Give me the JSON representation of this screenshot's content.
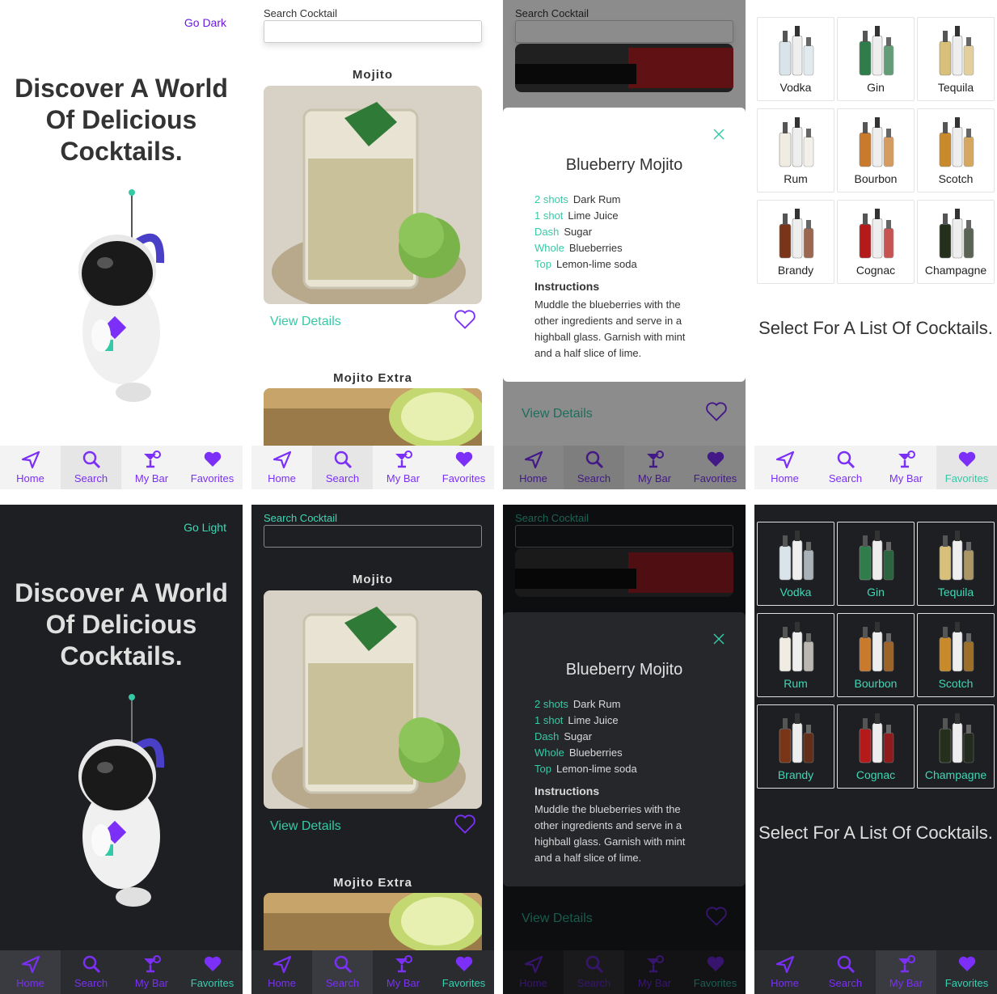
{
  "nav": {
    "home": "Home",
    "search": "Search",
    "mybar": "My Bar",
    "favorites": "Favorites"
  },
  "home": {
    "toggle_light": "Go Dark",
    "toggle_dark": "Go Light",
    "hero": "Discover A World Of Delicious Cocktails."
  },
  "search": {
    "label": "Search Cocktail",
    "placeholder": "",
    "results": [
      {
        "name": "Mojito",
        "action": "View Details"
      },
      {
        "name": "Mojito Extra"
      }
    ]
  },
  "detail": {
    "behind_action": "View Details",
    "title": "Blueberry Mojito",
    "ingredients": [
      {
        "amount": "2 shots",
        "name": "Dark Rum"
      },
      {
        "amount": "1 shot",
        "name": "Lime Juice"
      },
      {
        "amount": "Dash",
        "name": "Sugar"
      },
      {
        "amount": "Whole",
        "name": "Blueberries"
      },
      {
        "amount": "Top",
        "name": "Lemon-lime soda"
      }
    ],
    "instructions_title": "Instructions",
    "instructions": "Muddle the blueberries with the other ingredients and serve in a highball glass. Garnish with mint and a half slice of lime."
  },
  "bar": {
    "spirits": [
      "Vodka",
      "Gin",
      "Tequila",
      "Rum",
      "Bourbon",
      "Scotch",
      "Brandy",
      "Cognac",
      "Champagne"
    ],
    "prompt": "Select For A List Of Cocktails."
  },
  "colors": {
    "accent_purple": "#7b2ff7",
    "accent_teal": "#36c9a6",
    "dark_bg": "#1e1f22"
  }
}
